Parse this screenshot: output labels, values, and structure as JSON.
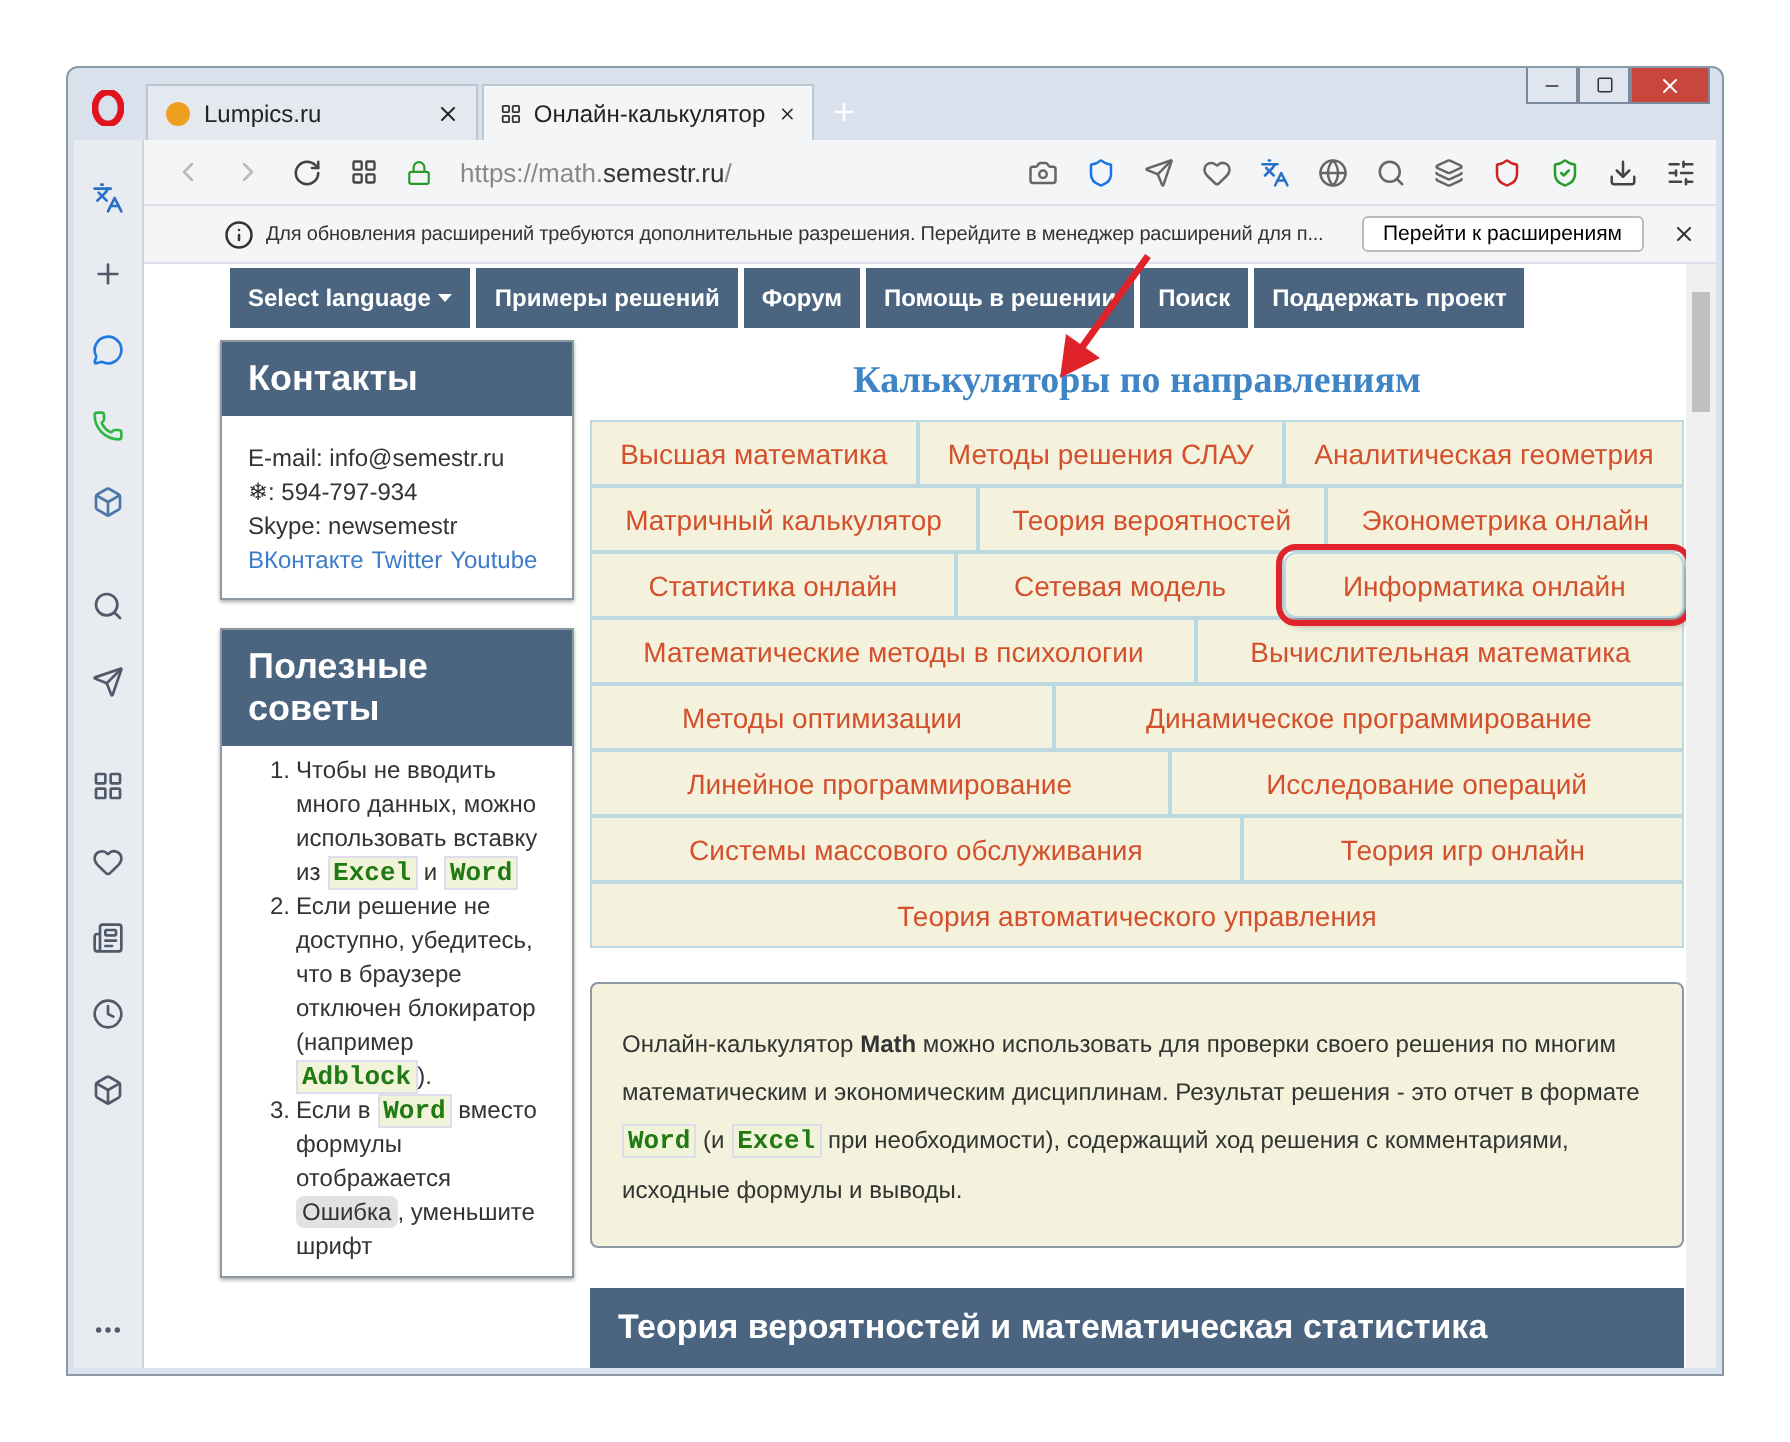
{
  "browser": {
    "tabs": [
      {
        "title": "Lumpics.ru",
        "selected": false
      },
      {
        "title": "Онлайн-калькулятор",
        "selected": true
      }
    ],
    "url_prefix": "https://math.",
    "url_domain": "semestr.ru",
    "url_suffix": "/",
    "infobar": {
      "text": "Для обновления расширений требуются дополнительные разрешения. Перейдите в менеджер расширений для п...",
      "button": "Перейти к расширениям"
    }
  },
  "nav": [
    {
      "label": "Select language",
      "dropdown": true
    },
    {
      "label": "Примеры решений",
      "dropdown": false
    },
    {
      "label": "Форум",
      "dropdown": false
    },
    {
      "label": "Помощь в решении",
      "dropdown": false
    },
    {
      "label": "Поиск",
      "dropdown": false
    },
    {
      "label": "Поддержать проект",
      "dropdown": false
    }
  ],
  "contacts": {
    "title": "Контакты",
    "lines": [
      "E-mail: info@semestr.ru",
      "❄: 594-797-934",
      "Skype: newsemestr"
    ],
    "links": [
      "ВКонтакте",
      "Twitter",
      "Youtube"
    ]
  },
  "tips": {
    "title": "Полезные советы",
    "items": [
      {
        "marker": "1.",
        "segments": [
          {
            "kind": "plain",
            "text": "Чтобы не вводить много данных, можно использовать вставку из "
          },
          {
            "kind": "code",
            "text": "Excel"
          },
          {
            "kind": "plain",
            "text": " и "
          },
          {
            "kind": "code",
            "text": "Word"
          }
        ]
      },
      {
        "marker": "2.",
        "segments": [
          {
            "kind": "plain",
            "text": "Если решение не доступно, убедитесь, что в браузере отключен блокиратор (например "
          },
          {
            "kind": "code",
            "text": "Adblock"
          },
          {
            "kind": "plain",
            "text": ")."
          }
        ]
      },
      {
        "marker": "3.",
        "segments": [
          {
            "kind": "plain",
            "text": "Если в "
          },
          {
            "kind": "code",
            "text": "Word"
          },
          {
            "kind": "plain",
            "text": " вместо формулы отображается "
          },
          {
            "kind": "error",
            "text": "Ошибка"
          },
          {
            "kind": "plain",
            "text": ", уменьшите шрифт"
          }
        ]
      }
    ]
  },
  "calculators": {
    "title": "Калькуляторы по направлениям",
    "rows": [
      {
        "items": [
          {
            "label": "Высшая математика",
            "highlighted": false
          },
          {
            "label": "Методы решения СЛАУ",
            "highlighted": false
          },
          {
            "label": "Аналитическая геометрия",
            "highlighted": false
          }
        ]
      },
      {
        "items": [
          {
            "label": "Матричный калькулятор",
            "highlighted": false
          },
          {
            "label": "Теория вероятностей",
            "highlighted": false
          },
          {
            "label": "Эконометрика онлайн",
            "highlighted": false
          }
        ]
      },
      {
        "items": [
          {
            "label": "Статистика онлайн",
            "highlighted": false
          },
          {
            "label": "Сетевая модель",
            "highlighted": false
          },
          {
            "label": "Информатика онлайн",
            "highlighted": true
          }
        ]
      },
      {
        "items": [
          {
            "label": "Математические методы в психологии",
            "highlighted": false
          },
          {
            "label": "Вычислительная математика",
            "highlighted": false
          }
        ]
      },
      {
        "items": [
          {
            "label": "Методы оптимизации",
            "highlighted": false
          },
          {
            "label": "Динамическое программирование",
            "highlighted": false
          }
        ]
      },
      {
        "items": [
          {
            "label": "Линейное программирование",
            "highlighted": false
          },
          {
            "label": "Исследование операций",
            "highlighted": false
          }
        ]
      },
      {
        "items": [
          {
            "label": "Системы массового обслуживания",
            "highlighted": false
          },
          {
            "label": "Теория игр онлайн",
            "highlighted": false
          }
        ]
      },
      {
        "items": [
          {
            "label": "Теория автоматического управления",
            "highlighted": false
          }
        ]
      }
    ]
  },
  "about": [
    {
      "kind": "plain",
      "text": "Онлайн-калькулятор "
    },
    {
      "kind": "bold",
      "text": "Math"
    },
    {
      "kind": "plain",
      "text": " можно использовать для проверки своего решения по многим математическим и экономическим дисциплинам. Результат решения - это отчет в формате "
    },
    {
      "kind": "code",
      "text": "Word"
    },
    {
      "kind": "plain",
      "text": " (и "
    },
    {
      "kind": "code",
      "text": "Excel"
    },
    {
      "kind": "plain",
      "text": " при необходимости), содержащий ход решения с комментариями, исходные формулы и выводы."
    }
  ],
  "section": {
    "title": "Теория вероятностей и математическая статистика"
  }
}
